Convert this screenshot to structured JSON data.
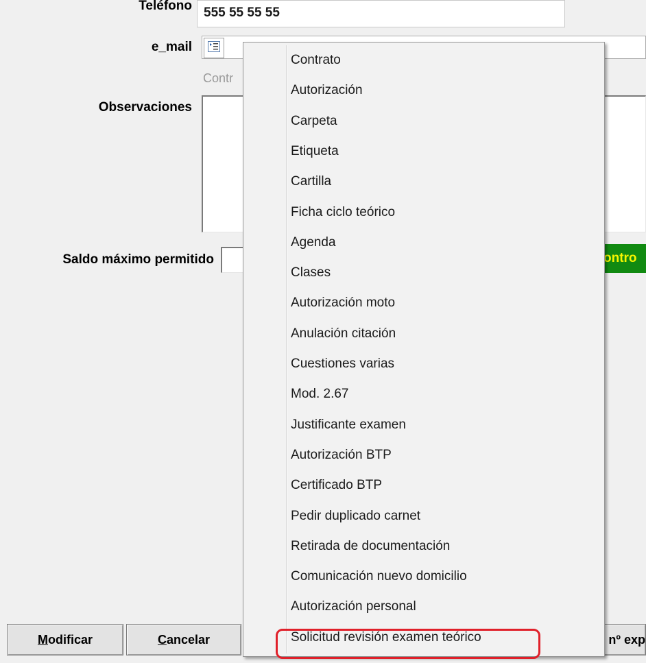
{
  "form": {
    "telefono_label": "Teléfono",
    "telefono_value": "555 55 55 55",
    "email_label": "e_mail",
    "email_hint": "Contr",
    "observaciones_label": "Observaciones",
    "saldo_label": "Saldo máximo permitido",
    "green_badge_text": "ontro"
  },
  "buttons": {
    "modificar_underline": "M",
    "modificar_rest": "odificar",
    "cancelar_underline": "C",
    "cancelar_rest": "ancelar",
    "right_partial": "nº exp"
  },
  "context_menu": {
    "items": [
      "Contrato",
      "Autorización",
      "Carpeta",
      "Etiqueta",
      "Cartilla",
      "Ficha ciclo teórico",
      "Agenda",
      "Clases",
      "Autorización moto",
      "Anulación citación",
      "Cuestiones varias",
      "Mod. 2.67",
      "Justificante examen",
      "Autorización BTP",
      "Certificado BTP",
      "Pedir duplicado carnet",
      "Retirada de documentación",
      "Comunicación nuevo domicilio",
      "Autorización personal",
      "Solicitud revisión examen teórico"
    ],
    "highlighted_index": 19,
    "highlight_color": "#e0202a"
  },
  "colors": {
    "badge_bg": "#118a11",
    "badge_text": "#f6f600"
  }
}
